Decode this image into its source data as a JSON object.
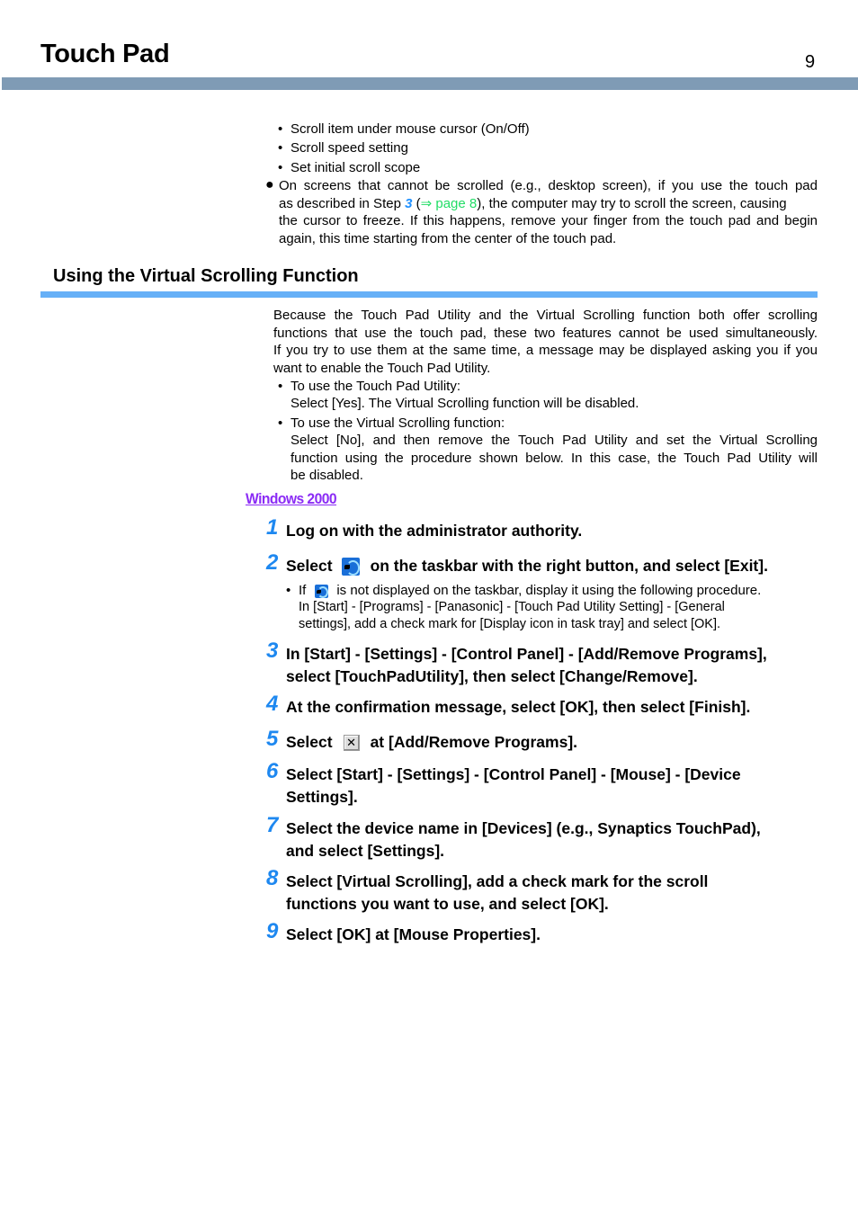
{
  "header": {
    "title": "Touch Pad",
    "page_number": "9",
    "bar_color": "#7f9bb5"
  },
  "top_bullets": [
    "Scroll item under mouse cursor (On/Off)",
    "Scroll speed setting",
    "Set initial scroll scope"
  ],
  "note": {
    "bullet": "●",
    "line1": "On screens that cannot be scrolled (e.g., desktop screen), if you use the touch pad",
    "line2_a": "as described in Step ",
    "step_ref": "3",
    "line2_b": " (",
    "page_ref": "⇒ page 8",
    "line2_c": "), the computer may try to scroll the screen, causing",
    "line3": "the cursor to freeze. If this happens, remove your finger from the touch pad and begin",
    "line4": "again, this time starting from the center of the touch pad."
  },
  "section": {
    "title": "Using the Virtual Scrolling Function",
    "bar_color": "#66b0f7",
    "intro": [
      "Because the Touch Pad Utility and the Virtual Scrolling function both offer scrolling",
      "functions that use the touch pad, these two features cannot be used simultaneously.",
      "If you try to use them at the same time, a message may be displayed asking you if you",
      "want to enable the Touch Pad Utility."
    ],
    "options": [
      {
        "label": "To use the Touch Pad Utility:",
        "lines": [
          "Select [Yes]. The Virtual Scrolling function will be disabled."
        ]
      },
      {
        "label": "To use the Virtual Scrolling function:",
        "lines": [
          "Select [No], and then remove the Touch Pad Utility and set the Virtual Scrolling",
          "function using the procedure shown below.  In this case, the Touch Pad Utility will",
          "be disabled."
        ]
      }
    ]
  },
  "os_tag": "Windows 2000",
  "steps": [
    {
      "num": "1",
      "lines": [
        "Log on with the administrator authority."
      ]
    },
    {
      "num": "2",
      "pre": "Select",
      "post": "on the taskbar with the right button, and select [Exit].",
      "icon": "touchpad-utility-icon"
    },
    {
      "num": "3",
      "lines": [
        "In [Start] - [Settings] - [Control Panel] - [Add/Remove Programs],",
        "select [TouchPadUtility], then select [Change/Remove]."
      ]
    },
    {
      "num": "4",
      "lines": [
        "At the confirmation message, select [OK], then select [Finish]."
      ]
    },
    {
      "num": "5",
      "pre": "Select",
      "post": "at [Add/Remove Programs].",
      "icon": "close-icon",
      "icon_glyph": "✕"
    },
    {
      "num": "6",
      "lines": [
        "Select [Start] - [Settings] - [Control Panel] - [Mouse] - [Device",
        "Settings]."
      ]
    },
    {
      "num": "7",
      "lines": [
        "Select the device name in [Devices] (e.g., Synaptics TouchPad),",
        "and select [Settings]."
      ]
    },
    {
      "num": "8",
      "lines": [
        "Select [Virtual Scrolling], add a check mark for the scroll",
        "functions you want to use, and select [OK]."
      ]
    },
    {
      "num": "9",
      "lines": [
        "Select [OK] at [Mouse Properties]."
      ]
    }
  ],
  "step2_note": {
    "pre": "If",
    "post": "is not displayed on the taskbar, display it using the following procedure.",
    "line2": "In [Start] - [Programs] - [Panasonic] - [Touch Pad Utility Setting] - [General",
    "line3": "settings], add a check mark for [Display icon in task tray] and select [OK]."
  }
}
